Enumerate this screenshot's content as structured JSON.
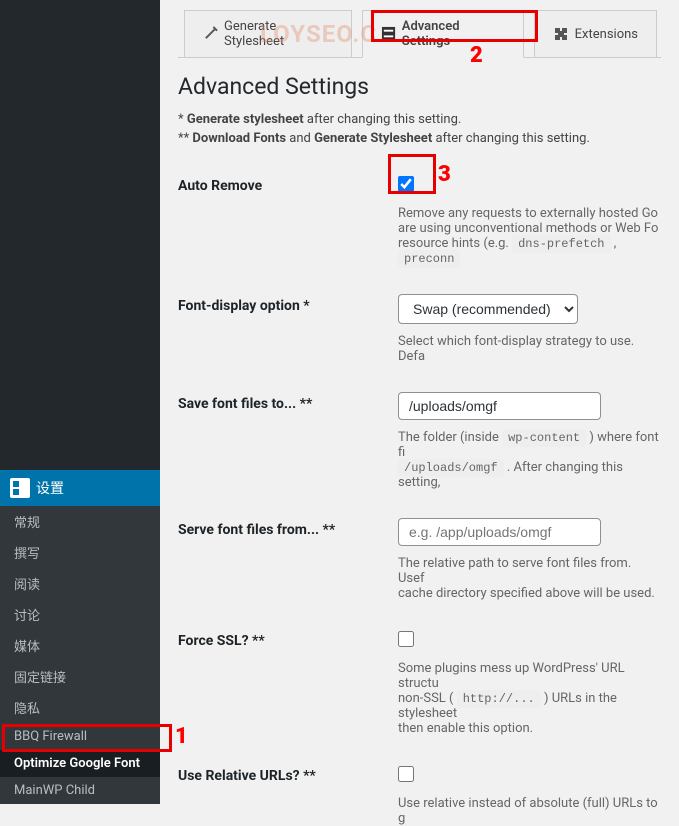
{
  "watermark": "LOYSEO.C",
  "sidebar": {
    "settings_label": "设置",
    "items": [
      {
        "label": "常规"
      },
      {
        "label": "撰写"
      },
      {
        "label": "阅读"
      },
      {
        "label": "讨论"
      },
      {
        "label": "媒体"
      },
      {
        "label": "固定链接"
      },
      {
        "label": "隐私"
      },
      {
        "label": "BBQ Firewall"
      },
      {
        "label": "Optimize Google Font"
      },
      {
        "label": "MainWP Child"
      }
    ],
    "active_index": 8
  },
  "tabs": [
    {
      "label": "Generate Stylesheet"
    },
    {
      "label": "Advanced Settings"
    },
    {
      "label": "Extensions"
    }
  ],
  "active_tab": 1,
  "section_title": "Advanced Settings",
  "notes": {
    "n1_pre": "* ",
    "n1_b": "Generate stylesheet",
    "n1_post": " after changing this setting.",
    "n2_pre": "** ",
    "n2_b1": "Download Fonts",
    "n2_mid": " and ",
    "n2_b2": "Generate Stylesheet",
    "n2_post": " after changing this setting."
  },
  "fields": {
    "auto_remove": {
      "label": "Auto Remove",
      "checked": true,
      "desc_a": "Remove any requests to externally hosted Go",
      "desc_b": "are using unconventional methods or Web Fo",
      "desc_c": "resource hints (e.g. ",
      "codes": {
        "c1": "dns-prefetch",
        "c2": "preconn"
      }
    },
    "font_display": {
      "label": "Font-display option *",
      "value": "Swap (recommended)",
      "desc": "Select which font-display strategy to use. Defa"
    },
    "save_to": {
      "label": "Save font files to... **",
      "value": "/uploads/omgf",
      "desc_a": "The folder (inside ",
      "code1": "wp-content",
      "desc_b": " ) where font fi",
      "code2": "/uploads/omgf",
      "desc_c": " . After changing this setting, "
    },
    "serve_from": {
      "label": "Serve font files from... **",
      "placeholder": "e.g. /app/uploads/omgf",
      "value": "",
      "desc_a": "The relative path to serve font files from. Usef",
      "desc_b": "cache directory specified above will be used."
    },
    "force_ssl": {
      "label": "Force SSL? **",
      "checked": false,
      "desc_a": "Some plugins mess up WordPress' URL structu",
      "desc_b": "non-SSL ( ",
      "code": "http://...",
      "desc_c": " ) URLs in the stylesheet",
      "desc_d": "then enable this option."
    },
    "relative": {
      "label": "Use Relative URLs? **",
      "checked": false,
      "desc": "Use relative instead of absolute (full) URLs to g"
    }
  },
  "markers": {
    "m1": "1",
    "m2": "2",
    "m3": "3"
  }
}
